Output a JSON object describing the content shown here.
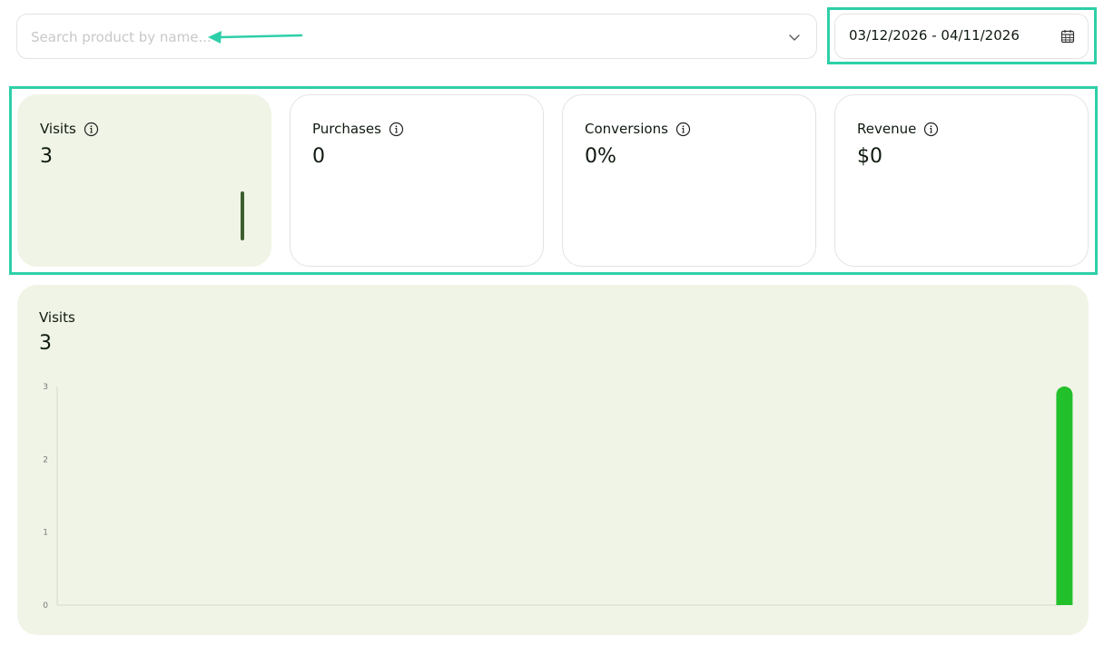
{
  "search": {
    "placeholder": "Search product by name..."
  },
  "date_range": {
    "value": "03/12/2026 - 04/11/2026"
  },
  "cards": [
    {
      "label": "Visits",
      "value": "3"
    },
    {
      "label": "Purchases",
      "value": "0"
    },
    {
      "label": "Conversions",
      "value": "0%"
    },
    {
      "label": "Revenue",
      "value": "$0"
    }
  ],
  "chart_panel": {
    "title": "Visits",
    "total": "3"
  },
  "colors": {
    "accent_highlight": "#2ecfa8",
    "panel_bg": "#f0f4e6",
    "bar_green": "#22c02a",
    "sparkbar": "#3d5f2e"
  },
  "chart_data": {
    "type": "bar",
    "title": "Visits",
    "xlabel": "",
    "ylabel": "",
    "ylim": [
      0,
      3
    ],
    "yticks": [
      0,
      1,
      2,
      3
    ],
    "grid": false,
    "bar_count": 30,
    "values": [
      0,
      0,
      0,
      0,
      0,
      0,
      0,
      0,
      0,
      0,
      0,
      0,
      0,
      0,
      0,
      0,
      0,
      0,
      0,
      0,
      0,
      0,
      0,
      0,
      0,
      0,
      0,
      0,
      0,
      3
    ]
  }
}
